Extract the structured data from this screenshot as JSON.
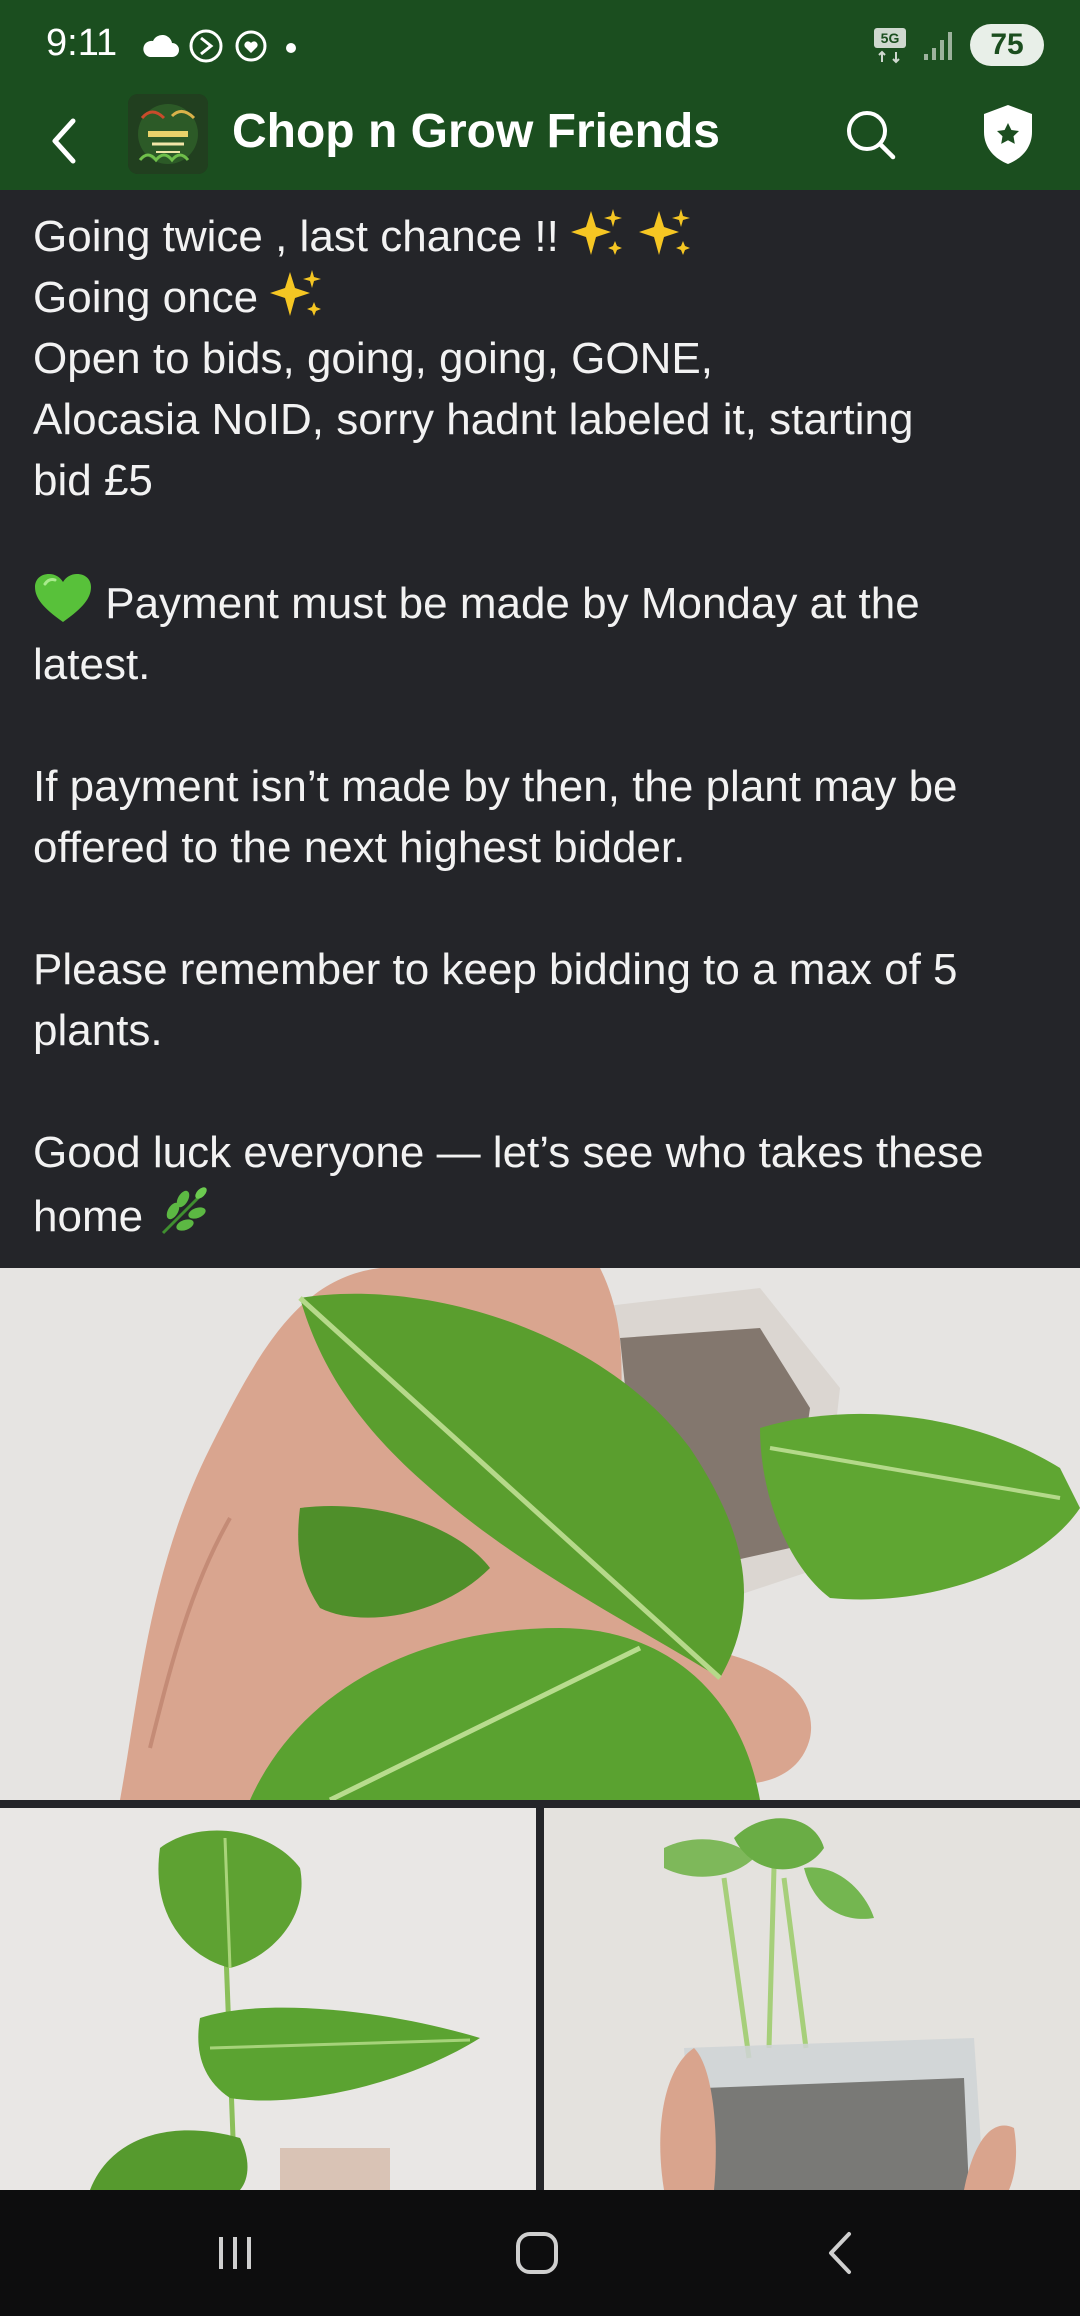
{
  "status_bar": {
    "time": "9:11",
    "network": "5G",
    "battery": "75"
  },
  "app_bar": {
    "title": "Chop n Grow Friends",
    "avatar_text": "Chop n Grow Friends"
  },
  "post": {
    "lines": [
      "Going twice , last chance !!",
      "Going once",
      "Open to bids, going, going, GONE,",
      "Alocasia NoID, sorry hadnt labeled it, starting",
      "bid £5",
      "Payment must be made by Monday at the",
      "latest.",
      "If payment isn’t made by then, the plant may be",
      "offered to the next highest bidder.",
      "Please remember to keep bidding to a max of 5",
      "plants.",
      "Good luck everyone — let’s see who takes these",
      "home"
    ]
  },
  "icons": {
    "back": "back-icon",
    "search": "search-icon",
    "shield": "shield-icon",
    "sparkles": "sparkles-icon",
    "heart": "green-heart-icon",
    "herb": "herb-icon"
  },
  "colors": {
    "header_green": "#1b4e1f",
    "background": "#242529",
    "heart_green": "#58c13a"
  }
}
